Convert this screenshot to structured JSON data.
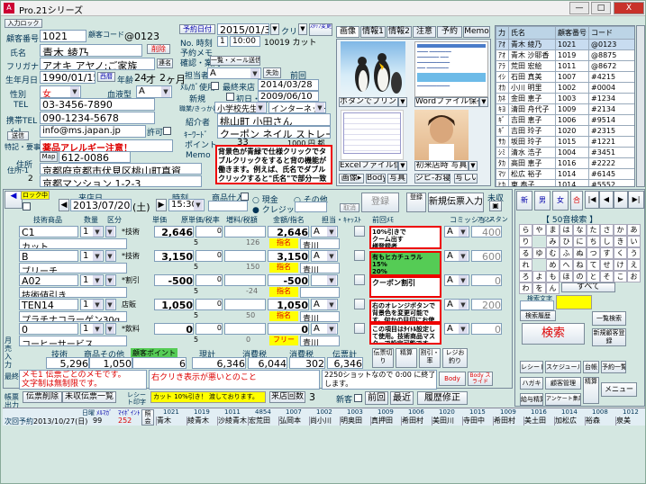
{
  "window": {
    "title": "Pro.21シリーズ",
    "min": "—",
    "max": "□",
    "close": "X"
  },
  "top_left": {
    "enter_btn": "入力ロック",
    "cust_no_label": "顧客番号",
    "cust_no": "1021",
    "cust_code_label": "顧客コード",
    "cust_code": "@0123",
    "name_label": "氏名",
    "name": "青木 綾乃",
    "kana_label": "フリガナ",
    "kana": "アオキ アヤノ:ご家族",
    "delete_btn": "削除",
    "link_btn": "連名",
    "birth_label": "生年月日",
    "birth": "1990/01/15",
    "age_label": "年齢",
    "age": "24",
    "age_unit": "才",
    "month": "2",
    "month_unit": "ヶ月",
    "western_label": "西暦",
    "gender_label": "性別",
    "gender": "女",
    "blood_label": "血液型",
    "blood": "A",
    "tel_label": "TEL",
    "tel": "03-3456-7890",
    "mobile_label": "携帯TEL",
    "mobile": "090-1234-5678",
    "mail_label": "ﾒｰﾙ",
    "mail_btn": "送信",
    "mail": "info@ms.japan.jp",
    "permit": "許可",
    "special_label": "特記・要事",
    "special": "薬品アレルギー注意！",
    "addr_label": "住所",
    "zip_btn": "Map",
    "zip": "612-0086",
    "addr1": "京都府京都市伏見区桃山町真資",
    "addr2": "京都マンション 1-2-3",
    "div_label": "住所-1",
    "div2": "2"
  },
  "reservation": {
    "date_label": "予約日付",
    "date": "2015/01/31",
    "clear": "クリア",
    "staff_btn": "ｽﾀｯﾌ変更",
    "no_label": "No. 時刻",
    "no_val": "1",
    "time": "10:00",
    "cut": "10019 カット",
    "memo_label": "予約メモ",
    "contact_label": "確認・案内",
    "list_btn": "一覧・メール送信"
  },
  "customer_info": {
    "staff_label": "担当者",
    "staff": "A",
    "expired_btn": "失効",
    "before_label": "前回",
    "method_label": "ﾒﾙ/ｶﾞ使用",
    "last_visit_label": "最終来店",
    "last_visit": "2014/03/28",
    "new_label": "新規",
    "first_label": "初日・割引",
    "first_date": "2009/06/10",
    "school_label": "職業/きっかけ",
    "school": "小学校先生",
    "internet": "インターネット",
    "intro_label": "紹介者",
    "intro": "桃山町 小田さん",
    "keyword_label": "ｷｰﾜｰﾄﾞ",
    "keyword": "クーポン ネイル ストレート",
    "point_label": "ポイント",
    "point": "33",
    "balance": "1000 円 都",
    "memo_label": "Memo",
    "note": "背景色が青緑で仕様クリックでタブルクリックをすると背の機能が働きます。例えば、氏名でダブルクリックすると\"氏名\"で部分一致検索が可能です。"
  },
  "photo_tabs": [
    "画像",
    "情報1",
    "情報2",
    "注意",
    "予約",
    "Memo"
  ],
  "photo": {
    "print_btn": "ボタンでプリント",
    "open_btn": "Wordファイル保存",
    "excel_btn": "Excelファイル保存",
    "first_photo": "初来店時 写真",
    "img_btn": "画像▸",
    "body_btn": "Body",
    "photo_btn": "写真",
    "zip_btn": "ジピ-お寝▸",
    "copy": "写しい"
  },
  "customer_list": {
    "headers": [
      "力",
      "氏名",
      "顧客番号",
      "コード"
    ],
    "rows": [
      {
        "m": "ｱｵ",
        "name": "青木 綾乃",
        "no": "1021",
        "code": "@0123"
      },
      {
        "m": "ｱｵ",
        "name": "青木 沙耶香",
        "no": "1019",
        "code": "@8875"
      },
      {
        "m": "ｱﾗ",
        "name": "荒田 宏絵",
        "no": "1011",
        "code": "@8672"
      },
      {
        "m": "ｲｼ",
        "name": "石田 真美",
        "no": "1007",
        "code": "#4215"
      },
      {
        "m": "ｵｶ",
        "name": "小川 明里",
        "no": "1002",
        "code": "#0004"
      },
      {
        "m": "ｶﾈ",
        "name": "金田 恵子",
        "no": "1003",
        "code": "#1234"
      },
      {
        "m": "ｷﾖ",
        "name": "清田 舟代子",
        "no": "1009",
        "code": "#2134"
      },
      {
        "m": "ｷﾞ",
        "name": "吉田 恵子",
        "no": "1006",
        "code": "#9514"
      },
      {
        "m": "ｷﾞ",
        "name": "吉田 玲子",
        "no": "1020",
        "code": "#2315"
      },
      {
        "m": "ｻｶ",
        "name": "坂田 玲子",
        "no": "1015",
        "code": "#1221"
      },
      {
        "m": "ｼﾐ",
        "name": "清水 浩子",
        "no": "1004",
        "code": "#3451"
      },
      {
        "m": "ﾀｶ",
        "name": "高田 恵子",
        "no": "1016",
        "code": "#2222"
      },
      {
        "m": "ﾏﾂ",
        "name": "松広 裕子",
        "no": "1014",
        "code": "#6145"
      },
      {
        "m": "ﾋｶ",
        "name": "東 泰子",
        "no": "1014",
        "code": "#5552"
      }
    ]
  },
  "sales": {
    "lock_label": "ロック中",
    "date_label": "来店日",
    "date": "2013/07/20",
    "weekday": "(土)",
    "time_label": "時刻",
    "time": "15:30",
    "goods_label": "商品仕入",
    "cash": "現金",
    "credit": "クレジット",
    "other": "その他",
    "register": "登録",
    "cancel": "取消",
    "new_slip": "新規伝票入力",
    "save_btn": "登録",
    "unfinish": "未収",
    "headers": [
      "技術商品",
      "数量",
      "区分",
      "単価",
      "原単価/税率",
      "増料/税額",
      "金額/指名",
      "担当・ｷｬｯｽﾄ",
      "前回ﾒﾓ",
      "コミッション",
      "アシスタント"
    ],
    "rows": [
      {
        "code": "C1",
        "qty": "1",
        "kind": "*技術",
        "price": "2,646",
        "tax": "0",
        "amount": "2,646",
        "staff": "A",
        "sub": "カット",
        "rate": "5",
        "taxamt": "126",
        "appoint": "指名",
        "assist": "青川",
        "com": "A",
        "cost": "400"
      },
      {
        "code": "B",
        "qty": "1",
        "kind": "*技術",
        "price": "3,150",
        "tax": "0",
        "amount": "3,150",
        "staff": "A",
        "sub": "ブリーチ",
        "rate": "5",
        "taxamt": "150",
        "appoint": "指名",
        "assist": "青川",
        "com": "A",
        "cost": "600"
      },
      {
        "code": "A02",
        "qty": "1",
        "kind": "*割引",
        "price": "-500",
        "tax": "0",
        "amount": "-500",
        "staff": "",
        "sub": "技術値引き",
        "rate": "5",
        "taxamt": "-24",
        "appoint": "指名",
        "assist": "",
        "com": "A",
        "cost": "0"
      },
      {
        "code": "TEN14",
        "qty": "1",
        "kind": "店販",
        "price": "1,050",
        "tax": "0",
        "amount": "1,050",
        "staff": "A",
        "sub": "プラチナコラーゲン30g",
        "rate": "5",
        "taxamt": "50",
        "appoint": "指名",
        "assist": "青川",
        "com": "A",
        "cost": "200"
      },
      {
        "code": "0",
        "qty": "1",
        "kind": "*飲料",
        "price": "0",
        "tax": "0",
        "amount": "0",
        "staff": "A",
        "sub": "コーヒーサービス",
        "rate": "5",
        "taxamt": "0",
        "appoint": "フリー",
        "assist": "青川",
        "com": "A",
        "cost": "0"
      }
    ]
  },
  "notes": {
    "n1": "10%引きで\nクーム出す\n様登録者\nについて",
    "n2": "有もヒカチュラル\n15%\n20%\n手元20%",
    "n3": "クーポン割引",
    "n4": "右のオレンジボタンで背景色を変更可能です。何かの目印にお使い下さい。",
    "n5": "この項目はﾀｲﾄﾙ設定して使用。技術商品マスターで設定可能です。"
  },
  "totals": {
    "tech_label": "技術",
    "goods_label": "商品その他",
    "point_label": "顧客ポイント",
    "collect_label": "現計",
    "tax_label": "消費税",
    "consume_label": "消費税",
    "slip_label": "伝票計",
    "tech": "5,296",
    "goods": "1,050",
    "collect": "6",
    "subtotal": "6,346",
    "tax": "6,044",
    "consume": "302",
    "total": "6,346",
    "slip_btn": "伝票切り",
    "change_label": "精算",
    "discount": "割引・率",
    "receipt": "レジお釣り"
  },
  "memo": {
    "label": "最終メモ",
    "text": "メモ1 伝票ごとのメモです。\n文字制は無制限です。",
    "text2": "右クリき表示が悪いとのこと",
    "text3": "2250ショットなので 0:00 に終了します。",
    "body": "Body",
    "slip": "Body スライド"
  },
  "footer": {
    "del_btn": "伝票削除",
    "unpaid": "未収伝票一覧",
    "receipt": "レシート印字",
    "cut_note": "カット 10%引き！ 渡しております。",
    "visit_label": "来店回数",
    "visit": "3",
    "new": "新客",
    "prev": "前回",
    "latest": "最近",
    "history": "履歴修正",
    "next_label": "次回予約",
    "next_date": "2013/10/27(日)",
    "day_label": "日曜",
    "num": "99",
    "num2": "252",
    "flow": "ﾒﾙﾏｶﾞ",
    "coupon": "ﾏｲﾎﾟｲﾝﾄ",
    "ref": "照会",
    "bottom_names": [
      "青木",
      "綾青木",
      "沙綾青木",
      "宏荒田",
      "弘岡本",
      "尚小川",
      "明奥田",
      "真押田",
      "希田村",
      "美田川",
      "寺田中",
      "希田村",
      "美土田",
      "加松広",
      "裕森",
      "泉美"
    ],
    "bottom_nums": [
      "1021",
      "1019",
      "1011",
      "4854",
      "1007",
      "1002",
      "1003",
      "1009",
      "1006",
      "1020",
      "1015",
      "1009",
      "1016",
      "1014",
      "1008",
      "1012",
      "1017"
    ]
  },
  "right_panel": {
    "btn_new": "新",
    "btn_male": "男",
    "btn_female": "女",
    "btn_unit": "合",
    "nav_first": "|◀",
    "nav_prev": "◀",
    "nav_next": "▶",
    "nav_last": "▶|",
    "search_label": "【 50音検索 】",
    "kana_rows": [
      [
        "ら",
        "や",
        "ま",
        "は",
        "な",
        "た",
        "さ",
        "か",
        "あ"
      ],
      [
        "り",
        "",
        "み",
        "ひ",
        "に",
        "ち",
        "し",
        "き",
        "い"
      ],
      [
        "る",
        "ゆ",
        "む",
        "ふ",
        "ぬ",
        "つ",
        "す",
        "く",
        "う"
      ],
      [
        "れ",
        "",
        "め",
        "へ",
        "ね",
        "て",
        "せ",
        "け",
        "え"
      ],
      [
        "ろ",
        "よ",
        "も",
        "ほ",
        "の",
        "と",
        "そ",
        "こ",
        "お"
      ],
      [
        "わ",
        "を",
        "ん",
        "",
        "",
        "",
        "",
        "",
        ""
      ]
    ],
    "all": "すべて",
    "search_record": "検索文字",
    "history": "検索履歴",
    "search": "検索",
    "list": "一覧検索",
    "customer": "新規顧客登録",
    "receipt": "レシート",
    "schedule": "スケジュール",
    "ledger": "台帳",
    "reservation": "予約一覧",
    "hagaki": "ハガキ",
    "customer_manage": "顧客管理",
    "menu": "メニュー",
    "payroll": "給与精算",
    "anketo": "アンケート集計",
    "pay": "精算"
  }
}
